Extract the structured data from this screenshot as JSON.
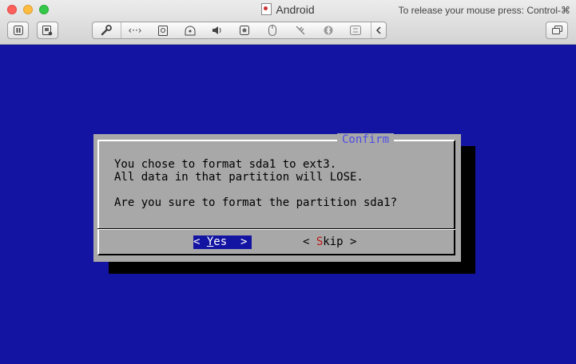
{
  "window": {
    "title": "Android",
    "release_hint": "To release your mouse press: Control-⌘"
  },
  "toolbar": {
    "pause_icon": "pause-icon",
    "snapshot_icon": "snapshot-icon",
    "restore_icon": "restore-window-icon",
    "device_icons": [
      "wrench-icon",
      "network-icon",
      "hard-disk-icon",
      "optical-drive-icon",
      "sound-icon",
      "camera-icon",
      "mouse-icon",
      "usb-icon",
      "bluetooth-icon",
      "sharing-icon",
      "collapse-chevron-icon"
    ]
  },
  "dialog": {
    "title": "Confirm",
    "line1": "You chose to format sda1 to ext3.",
    "line2": "All data in that partition will LOSE.",
    "line3": "Are you sure to format the partition sda1?",
    "yes": {
      "open": "< ",
      "hotkey": "Y",
      "rest": "es",
      "close": "  >"
    },
    "skip": {
      "open": "< ",
      "hotkey": "S",
      "rest": "kip",
      "close": " >"
    }
  },
  "colors": {
    "console_background": "#1414a3",
    "dialog_background": "#a8a8a8",
    "dialog_title": "#4c4ce6",
    "selected_button": "#1414a3",
    "hotkey_red": "#c01818"
  }
}
